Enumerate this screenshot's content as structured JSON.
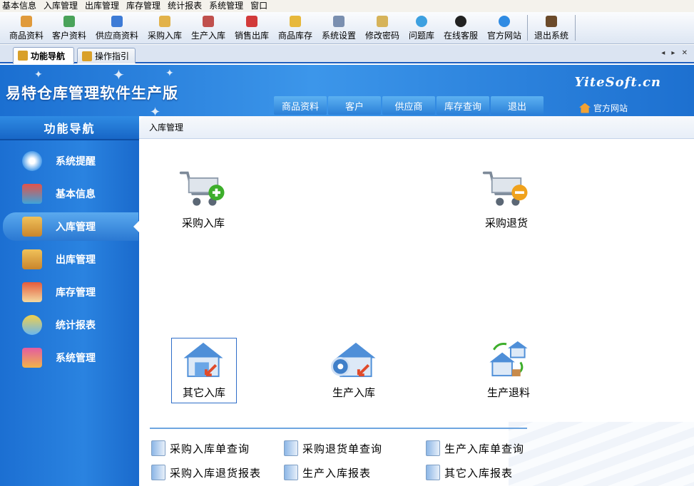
{
  "menu": [
    "基本信息",
    "入库管理",
    "出库管理",
    "库存管理",
    "统计报表",
    "系统管理",
    "窗口"
  ],
  "toolbar": [
    {
      "label": "商品资料",
      "icon": "goods-icon"
    },
    {
      "label": "客户资料",
      "icon": "customer-icon"
    },
    {
      "label": "供应商资料",
      "icon": "supplier-icon"
    },
    {
      "label": "采购入库",
      "icon": "truck-icon"
    },
    {
      "label": "生产入库",
      "icon": "production-icon"
    },
    {
      "label": "销售出库",
      "icon": "cart-icon"
    },
    {
      "label": "商品库存",
      "icon": "box-icon"
    },
    {
      "label": "系统设置",
      "icon": "settings-icon"
    },
    {
      "label": "修改密码",
      "icon": "key-icon"
    },
    {
      "label": "问题库",
      "icon": "question-icon"
    },
    {
      "label": "在线客服",
      "icon": "qq-icon"
    },
    {
      "label": "官方网站",
      "icon": "ie-icon"
    },
    {
      "label": "退出系统",
      "icon": "exit-icon"
    }
  ],
  "tabs": [
    "功能导航",
    "操作指引"
  ],
  "banner": {
    "title": "易特仓库管理软件生产版",
    "brand": "YiteSoft.cn",
    "home_link": "官方网站",
    "nav": [
      "商品资料",
      "客户",
      "供应商",
      "库存查询",
      "退出"
    ]
  },
  "sidebar": {
    "header": "功能导航",
    "items": [
      "系统提醒",
      "基本信息",
      "入库管理",
      "出库管理",
      "库存管理",
      "统计报表",
      "系统管理"
    ],
    "active_index": 2
  },
  "content": {
    "breadcrumb": "入库管理",
    "actions": [
      "采购入库",
      "采购退货",
      "其它入库",
      "生产入库",
      "生产退料"
    ],
    "queries": [
      "采购入库单查询",
      "采购退货单查询",
      "生产入库单查询",
      "采购入库退货报表",
      "生产入库报表",
      "其它入库报表"
    ]
  },
  "colors": {
    "accent": "#1f6fd0",
    "sidebar": "#2a83e0",
    "highlight": "#5aa9ee"
  }
}
